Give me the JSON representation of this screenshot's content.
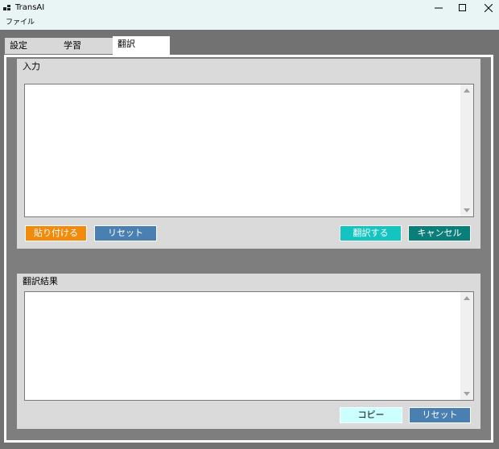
{
  "window": {
    "title": "TransAI",
    "minimize_icon": "minimize-icon",
    "maximize_icon": "maximize-icon",
    "close_icon": "close-icon"
  },
  "menu": {
    "file_label": "ファイル"
  },
  "tabs": [
    {
      "label": "設定",
      "active": false
    },
    {
      "label": "学習",
      "active": false
    },
    {
      "label": "翻訳",
      "active": true
    }
  ],
  "input_panel": {
    "title": "入力",
    "text": "",
    "buttons": {
      "paste": "貼り付ける",
      "reset": "リセット",
      "translate": "翻訳する",
      "cancel": "キャンセル"
    }
  },
  "result_panel": {
    "title": "翻訳結果",
    "text": "",
    "buttons": {
      "copy": "コピー",
      "reset": "リセット"
    }
  },
  "colors": {
    "paste_button": "#f28a0c",
    "reset_button": "#4a7fb1",
    "translate_button": "#14c4c0",
    "cancel_button": "#0a7e78",
    "copy_button": "#ccffff"
  }
}
